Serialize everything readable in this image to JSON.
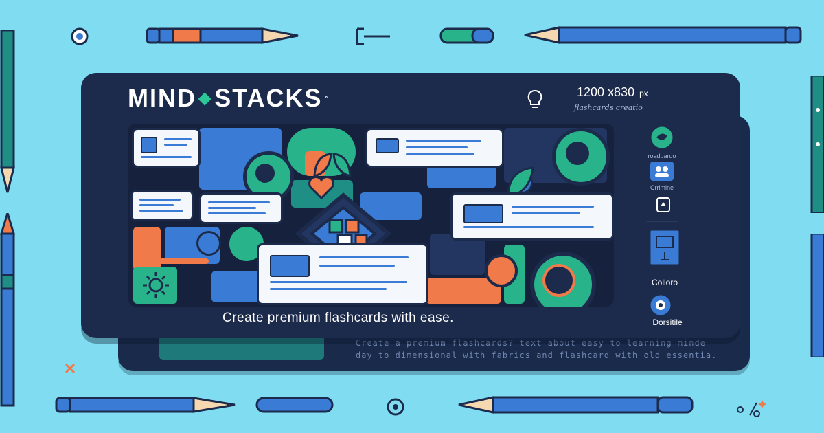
{
  "brand": {
    "name_left": "MIND",
    "name_right": "STACKS",
    "separator": "⬥",
    "reg": "°"
  },
  "dimensions": {
    "size": "1200 x830",
    "unit": "px",
    "subtitle": "flashcards creatio"
  },
  "tagline": "Create premium flashcards with ease.",
  "back_card": {
    "line1": "Create a premium flashcards? text about easy to learning minde",
    "line2": "day to dimensional with fabrics and flashcard with old essentia."
  },
  "sidebar": {
    "items": [
      {
        "icon": "leaf-icon",
        "label": "roadbardo"
      },
      {
        "icon": "people-icon",
        "label": "Crrimine"
      },
      {
        "icon": "document-icon",
        "label": "—————"
      },
      {
        "icon": "window-icon",
        "label": "Colloro"
      },
      {
        "icon": "flower-icon",
        "label": "Dorsitile"
      }
    ]
  },
  "colors": {
    "background": "#7fdcf1",
    "card": "#1c2b4b",
    "accent_green": "#29b38a",
    "accent_blue": "#3a7bd5",
    "accent_orange": "#f07a4a"
  }
}
